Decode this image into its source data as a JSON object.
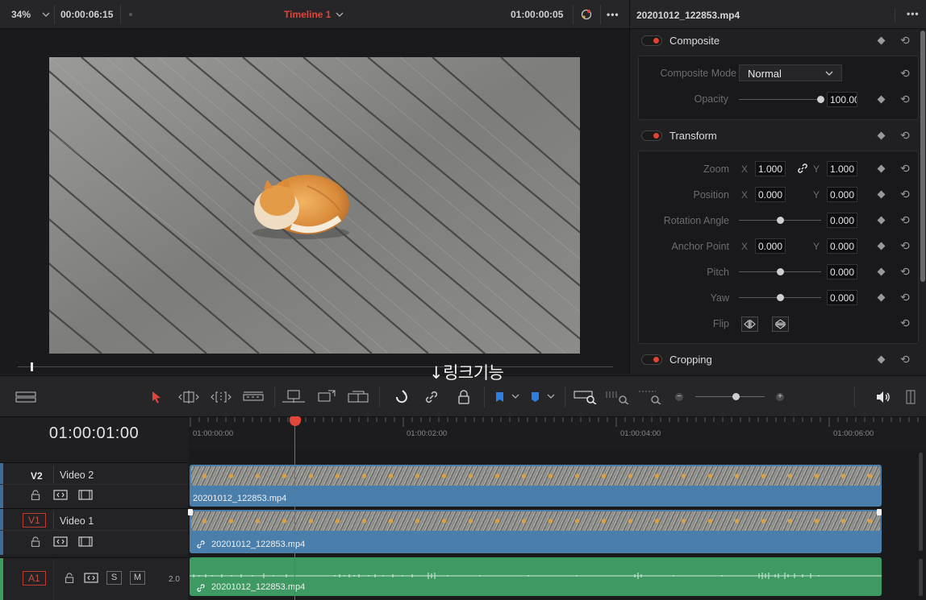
{
  "viewer": {
    "zoom": "34%",
    "source_timecode": "00:00:06:15",
    "timeline_name": "Timeline 1",
    "record_timecode": "01:00:00:05"
  },
  "inspector": {
    "clip_name": "20201012_122853.mp4",
    "composite": {
      "title": "Composite",
      "mode_label": "Composite Mode",
      "mode_value": "Normal",
      "opacity_label": "Opacity",
      "opacity_value": "100.00"
    },
    "transform": {
      "title": "Transform",
      "zoom_label": "Zoom",
      "zoom_x": "1.000",
      "zoom_y": "1.000",
      "position_label": "Position",
      "position_x": "0.000",
      "position_y": "0.000",
      "rotation_label": "Rotation Angle",
      "rotation_value": "0.000",
      "anchor_label": "Anchor Point",
      "anchor_x": "0.000",
      "anchor_y": "0.000",
      "pitch_label": "Pitch",
      "pitch_value": "0.000",
      "yaw_label": "Yaw",
      "yaw_value": "0.000",
      "flip_label": "Flip",
      "axis_x": "X",
      "axis_y": "Y"
    },
    "cropping": {
      "title": "Cropping"
    }
  },
  "annotation": "↓링크기능",
  "timeline": {
    "timecode": "01:00:01:00",
    "ruler": [
      "01:00:00:00",
      "01:00:02:00",
      "01:00:04:00",
      "01:00:06:00"
    ],
    "tracks": [
      {
        "id": "V2",
        "name": "Video 2",
        "clip": "20201012_122853.mp4"
      },
      {
        "id": "V1",
        "name": "Video 1",
        "clip": "20201012_122853.mp4"
      },
      {
        "id": "A1",
        "level": "2.0",
        "clip": "20201012_122853.mp4",
        "solo": "S",
        "mute": "M"
      }
    ]
  },
  "colors": {
    "accent_red": "#e0443a",
    "video_clip": "#4a7eab",
    "audio_clip": "#3e9a62",
    "panel_bg": "#202022"
  },
  "icons": [
    "monitor-icon",
    "prev-mark-icon",
    "jog-icon",
    "skip-start-icon",
    "play-reverse-icon",
    "stop-icon",
    "play-icon",
    "skip-end-icon",
    "loop-icon",
    "match-frame-icon",
    "next-edit-icon",
    "prev-edit-icon",
    "selection-icon",
    "trim-icon",
    "dynamic-trim-icon",
    "blade-icon",
    "insert-icon",
    "overwrite-icon",
    "replace-icon",
    "snapping-icon",
    "link-icon",
    "lock-icon",
    "flag-icon",
    "marker-icon",
    "zoom-full-icon",
    "zoom-detail-icon",
    "zoom-custom-icon",
    "volume-icon"
  ]
}
